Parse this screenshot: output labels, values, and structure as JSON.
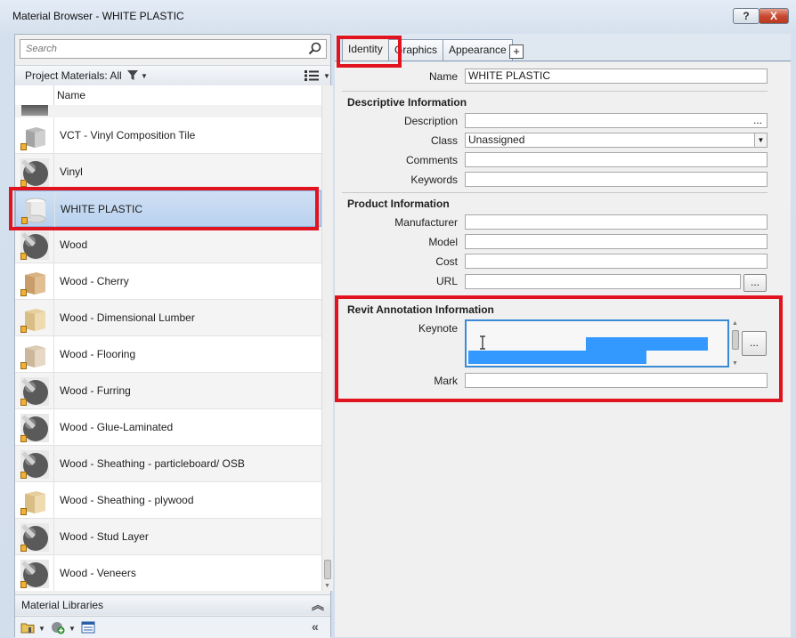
{
  "window": {
    "title": "Material Browser - WHITE PLASTIC",
    "help_label": "?",
    "close_label": "X"
  },
  "search": {
    "placeholder": "Search"
  },
  "project": {
    "label": "Project Materials: All"
  },
  "list": {
    "header_name": "Name",
    "items": [
      {
        "label": "VCT - Vinyl Composition Tile",
        "icon": "cube-gray-icon",
        "selected": false
      },
      {
        "label": "Vinyl",
        "icon": "sphere-dark-icon",
        "selected": false
      },
      {
        "label": "WHITE PLASTIC",
        "icon": "cylinder-white-icon",
        "selected": true
      },
      {
        "label": "Wood",
        "icon": "sphere-dark-icon",
        "selected": false
      },
      {
        "label": "Wood - Cherry",
        "icon": "cube-wood-icon",
        "selected": false
      },
      {
        "label": "Wood - Dimensional Lumber",
        "icon": "cube-lightwood-icon",
        "selected": false
      },
      {
        "label": "Wood - Flooring",
        "icon": "cube-pale-icon",
        "selected": false
      },
      {
        "label": "Wood - Furring",
        "icon": "sphere-dark-icon",
        "selected": false
      },
      {
        "label": "Wood - Glue-Laminated",
        "icon": "sphere-dark-icon",
        "selected": false
      },
      {
        "label": "Wood - Sheathing - particleboard/ OSB",
        "icon": "sphere-dark-icon",
        "selected": false
      },
      {
        "label": "Wood - Sheathing - plywood",
        "icon": "cube-lightwood-icon",
        "selected": false
      },
      {
        "label": "Wood - Stud Layer",
        "icon": "sphere-dark-icon",
        "selected": false
      },
      {
        "label": "Wood - Veneers",
        "icon": "sphere-dark-icon",
        "selected": false
      }
    ]
  },
  "libraries": {
    "label": "Material Libraries"
  },
  "tabs": [
    {
      "label": "Identity",
      "active": true
    },
    {
      "label": "Graphics",
      "active": false
    },
    {
      "label": "Appearance",
      "active": false
    },
    {
      "label": "+",
      "active": false
    }
  ],
  "identity": {
    "name_label": "Name",
    "name_value": "WHITE PLASTIC",
    "descriptive": {
      "heading": "Descriptive Information",
      "description_label": "Description",
      "description_value": "",
      "description_btn": "...",
      "class_label": "Class",
      "class_value": "Unassigned",
      "comments_label": "Comments",
      "comments_value": "",
      "keywords_label": "Keywords",
      "keywords_value": ""
    },
    "product": {
      "heading": "Product Information",
      "manufacturer_label": "Manufacturer",
      "manufacturer_value": "",
      "model_label": "Model",
      "model_value": "",
      "cost_label": "Cost",
      "cost_value": "",
      "url_label": "URL",
      "url_value": "",
      "url_btn": "..."
    },
    "annotation": {
      "heading": "Revit Annotation Information",
      "keynote_label": "Keynote",
      "keynote_btn": "...",
      "mark_label": "Mark",
      "mark_value": ""
    }
  },
  "colors": {
    "highlight": "#e0131f",
    "selection": "#3399ff",
    "selected_row": "#b9d1ee"
  }
}
